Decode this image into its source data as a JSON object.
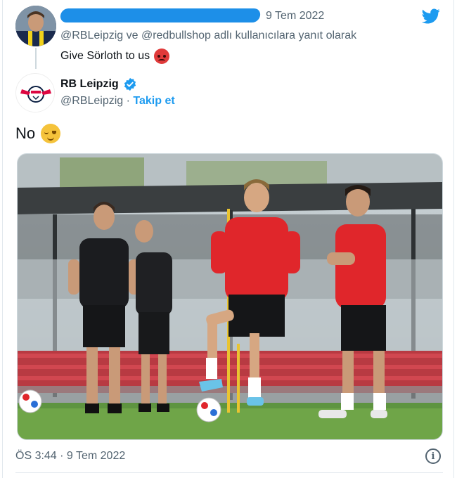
{
  "reply_tweet": {
    "date": "9 Tem 2022",
    "reply_context": "@RBLeipzig ve @redbullshop adlı kullanıcılara yanıt olarak",
    "text": "Give Sörloth to us",
    "emoji": "angry-face-icon"
  },
  "main_tweet": {
    "name": "RB Leipzig",
    "handle": "@RBLeipzig",
    "separator": " · ",
    "follow_label": "Takip et",
    "text": "No",
    "emoji": "relieved-face-icon",
    "timestamp": "ÖS 3:44 · 9 Tem 2022"
  },
  "colors": {
    "accent": "#1d9bf0",
    "muted": "#536471",
    "text": "#0f1419"
  }
}
